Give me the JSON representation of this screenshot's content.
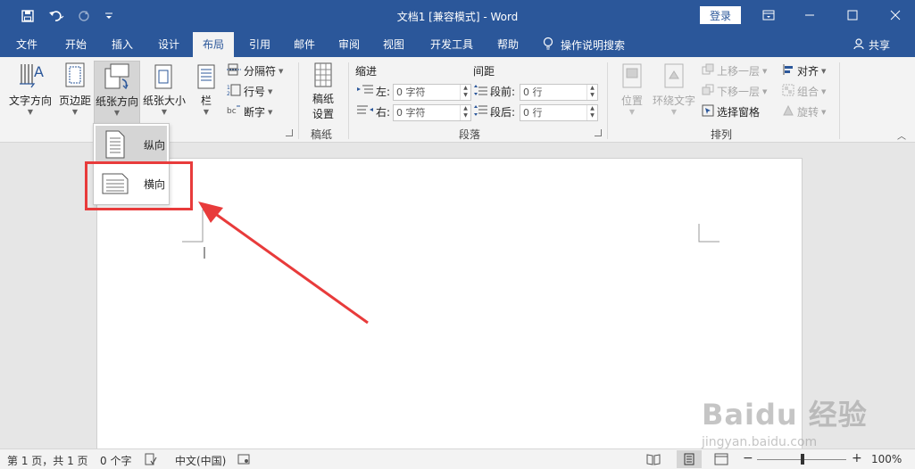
{
  "window": {
    "title": "文档1 [兼容模式]  -  Word",
    "login_label": "登录"
  },
  "tabs": [
    {
      "label": "文件",
      "active": false
    },
    {
      "label": "开始",
      "active": false
    },
    {
      "label": "插入",
      "active": false
    },
    {
      "label": "设计",
      "active": false
    },
    {
      "label": "布局",
      "active": true
    },
    {
      "label": "引用",
      "active": false
    },
    {
      "label": "邮件",
      "active": false
    },
    {
      "label": "审阅",
      "active": false
    },
    {
      "label": "视图",
      "active": false
    },
    {
      "label": "开发工具",
      "active": false
    },
    {
      "label": "帮助",
      "active": false
    }
  ],
  "tell_me": "操作说明搜索",
  "share": "共享",
  "ribbon": {
    "page_setup": {
      "text_direction": "文字方向",
      "margins": "页边距",
      "orientation": "纸张方向",
      "size": "纸张大小",
      "columns": "栏",
      "breaks": "分隔符",
      "line_numbers": "行号",
      "hyphenation": "断字"
    },
    "manuscript": {
      "settings_line1": "稿纸",
      "settings_line2": "设置",
      "group_label": "稿纸"
    },
    "paragraph": {
      "indent_header": "缩进",
      "spacing_header": "间距",
      "left_label": "左:",
      "right_label": "右:",
      "before_label": "段前:",
      "after_label": "段后:",
      "left_value": "0 字符",
      "right_value": "0 字符",
      "before_value": "0 行",
      "after_value": "0 行",
      "group_label": "段落"
    },
    "arrange": {
      "position": "位置",
      "wrap_text": "环绕文字",
      "bring_forward": "上移一层",
      "send_backward": "下移一层",
      "selection_pane": "选择窗格",
      "align": "对齐",
      "group": "组合",
      "rotate": "旋转",
      "group_label": "排列"
    }
  },
  "orientation_menu": {
    "portrait": "纵向",
    "landscape": "横向"
  },
  "status": {
    "page": "第 1 页，共 1 页",
    "words": "0 个字",
    "language": "中文(中国)",
    "zoom": "100%"
  },
  "watermark": {
    "brand": "Baidu 经验",
    "url": "jingyan.baidu.com"
  },
  "colors": {
    "accent": "#2b579a",
    "highlight": "#e83b3b"
  }
}
